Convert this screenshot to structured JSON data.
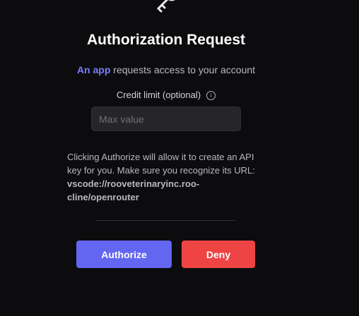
{
  "header": {
    "icon": "key-icon",
    "title": "Authorization Request"
  },
  "request": {
    "app_name": "An app",
    "text": " requests access to your account"
  },
  "credit_limit": {
    "label": "Credit limit (optional)",
    "info_icon": "info-icon",
    "info_glyph": "i",
    "placeholder": "Max value",
    "value": ""
  },
  "notice": {
    "text": "Clicking Authorize will allow it to create an API key for you. Make sure you recognize its URL:",
    "url": "vscode://rooveterinaryinc.roo-cline/openrouter"
  },
  "actions": {
    "authorize_label": "Authorize",
    "deny_label": "Deny"
  },
  "colors": {
    "background": "#0c0c0e",
    "accent": "#6366f1",
    "danger": "#ef4444",
    "link": "#7b7dff"
  }
}
